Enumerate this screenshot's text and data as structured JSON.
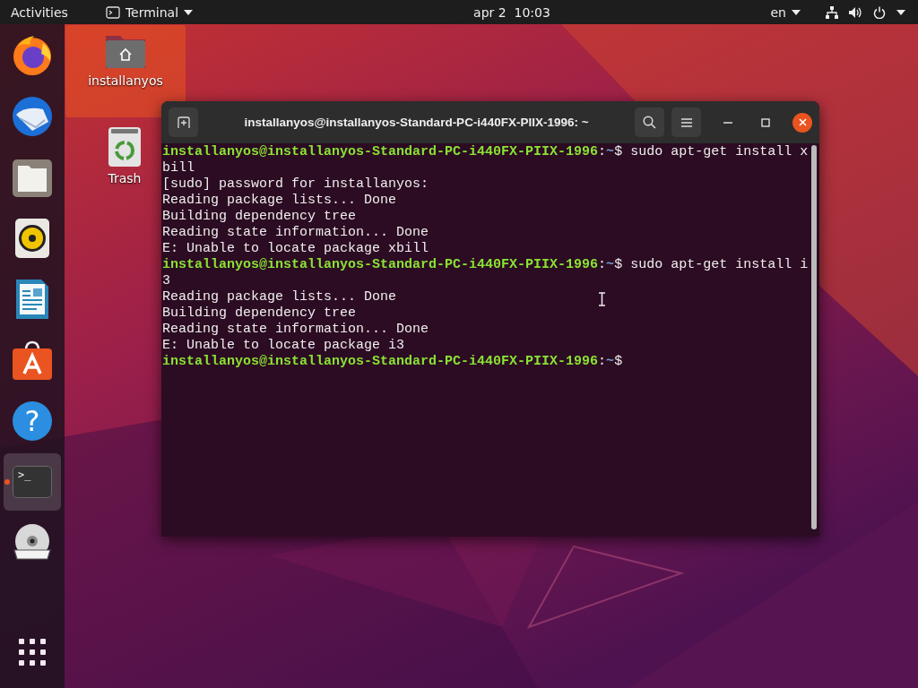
{
  "top_bar": {
    "activities": "Activities",
    "app_menu": "Terminal",
    "clock": "apr 2  10:03",
    "language": "en"
  },
  "dock": {
    "items": [
      {
        "kind": "firefox",
        "running": false,
        "selected": false
      },
      {
        "kind": "thunderbird",
        "running": false,
        "selected": false
      },
      {
        "kind": "files",
        "running": false,
        "selected": false
      },
      {
        "kind": "rhythmbox",
        "running": false,
        "selected": false
      },
      {
        "kind": "writer",
        "running": false,
        "selected": false
      },
      {
        "kind": "software",
        "running": false,
        "selected": false
      },
      {
        "kind": "help",
        "running": false,
        "selected": false,
        "glyph": "?"
      },
      {
        "kind": "terminal",
        "running": true,
        "selected": true,
        "glyph": ">_"
      },
      {
        "kind": "dvd",
        "running": false,
        "selected": false
      }
    ]
  },
  "desktop_icons": [
    {
      "kind": "home",
      "label": "installanyos",
      "selected": true
    },
    {
      "kind": "trash",
      "label": "Trash",
      "selected": false
    }
  ],
  "terminal": {
    "title": "installanyos@installanyos-Standard-PC-i440FX-PIIX-1996: ~",
    "lines": [
      [
        {
          "kind": "host",
          "text": "installanyos@installanyos-Standard-PC-i440FX-PIIX-1996"
        },
        {
          "kind": "plain",
          "text": ":"
        },
        {
          "kind": "path",
          "text": "~"
        },
        {
          "kind": "plain",
          "text": "$ sudo apt-get install x"
        }
      ],
      [
        {
          "kind": "plain",
          "text": "bill"
        }
      ],
      [
        {
          "kind": "plain",
          "text": "[sudo] password for installanyos:"
        }
      ],
      [
        {
          "kind": "plain",
          "text": "Reading package lists... Done"
        }
      ],
      [
        {
          "kind": "plain",
          "text": "Building dependency tree"
        }
      ],
      [
        {
          "kind": "plain",
          "text": "Reading state information... Done"
        }
      ],
      [
        {
          "kind": "plain",
          "text": "E: Unable to locate package xbill"
        }
      ],
      [
        {
          "kind": "host",
          "text": "installanyos@installanyos-Standard-PC-i440FX-PIIX-1996"
        },
        {
          "kind": "plain",
          "text": ":"
        },
        {
          "kind": "path",
          "text": "~"
        },
        {
          "kind": "plain",
          "text": "$ sudo apt-get install i"
        }
      ],
      [
        {
          "kind": "plain",
          "text": "3"
        }
      ],
      [
        {
          "kind": "plain",
          "text": "Reading package lists... Done"
        }
      ],
      [
        {
          "kind": "plain",
          "text": "Building dependency tree"
        }
      ],
      [
        {
          "kind": "plain",
          "text": "Reading state information... Done"
        }
      ],
      [
        {
          "kind": "plain",
          "text": "E: Unable to locate package i3"
        }
      ],
      [
        {
          "kind": "host",
          "text": "installanyos@installanyos-Standard-PC-i440FX-PIIX-1996"
        },
        {
          "kind": "plain",
          "text": ":"
        },
        {
          "kind": "path",
          "text": "~"
        },
        {
          "kind": "plain",
          "text": "$"
        }
      ]
    ]
  }
}
